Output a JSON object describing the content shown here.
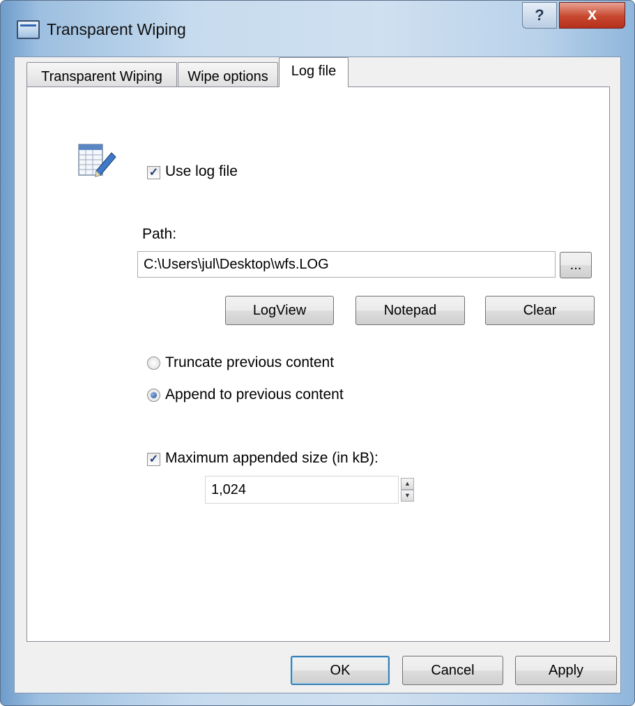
{
  "window": {
    "title": "Transparent Wiping",
    "help_label": "?",
    "close_label": "x"
  },
  "tabs": [
    {
      "label": "Transparent Wiping"
    },
    {
      "label": "Wipe options"
    },
    {
      "label": "Log file"
    }
  ],
  "log": {
    "use_log_label": "Use log file",
    "use_log_checked": true,
    "path_label": "Path:",
    "path_value": "C:\\Users\\jul\\Desktop\\wfs.LOG",
    "browse_label": "...",
    "logview_label": "LogView",
    "notepad_label": "Notepad",
    "clear_label": "Clear",
    "truncate_label": "Truncate previous content",
    "append_label": "Append to previous content",
    "selected_mode": "append",
    "max_size_label": "Maximum appended size (in kB):",
    "max_size_checked": true,
    "max_size_value": "1,024",
    "spin_up_glyph": "▲",
    "spin_down_glyph": "▼",
    "check_glyph": "✓"
  },
  "footer": {
    "ok_label": "OK",
    "cancel_label": "Cancel",
    "apply_label": "Apply"
  }
}
